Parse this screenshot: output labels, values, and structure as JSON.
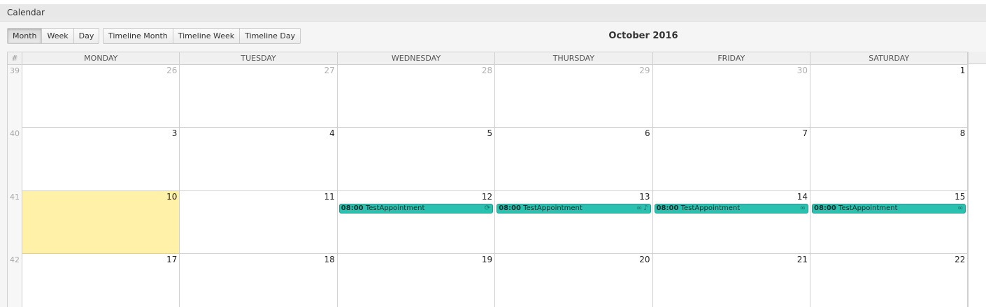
{
  "panel": {
    "title": "Calendar"
  },
  "views": {
    "basic": [
      {
        "label": "Month",
        "active": true
      },
      {
        "label": "Week",
        "active": false
      },
      {
        "label": "Day",
        "active": false
      }
    ],
    "timeline": [
      {
        "label": "Timeline Month",
        "active": false
      },
      {
        "label": "Timeline Week",
        "active": false
      },
      {
        "label": "Timeline Day",
        "active": false
      }
    ]
  },
  "calendar": {
    "title": "October 2016",
    "week_header": "#",
    "days": [
      "MONDAY",
      "TUESDAY",
      "WEDNESDAY",
      "THURSDAY",
      "FRIDAY",
      "SATURDAY"
    ],
    "weeks": [
      {
        "num": "39",
        "dates": [
          {
            "d": "26",
            "other": true
          },
          {
            "d": "27",
            "other": true
          },
          {
            "d": "28",
            "other": true
          },
          {
            "d": "29",
            "other": true
          },
          {
            "d": "30",
            "other": true
          },
          {
            "d": "1",
            "other": false
          }
        ]
      },
      {
        "num": "40",
        "dates": [
          {
            "d": "3"
          },
          {
            "d": "4"
          },
          {
            "d": "5"
          },
          {
            "d": "6"
          },
          {
            "d": "7"
          },
          {
            "d": "8"
          }
        ]
      },
      {
        "num": "41",
        "dates": [
          {
            "d": "10",
            "today": true
          },
          {
            "d": "11"
          },
          {
            "d": "12",
            "event": 0
          },
          {
            "d": "13",
            "event": 1
          },
          {
            "d": "14",
            "event": 2
          },
          {
            "d": "15",
            "event": 3
          }
        ]
      },
      {
        "num": "42",
        "dates": [
          {
            "d": "17"
          },
          {
            "d": "18"
          },
          {
            "d": "19"
          },
          {
            "d": "20"
          },
          {
            "d": "21"
          },
          {
            "d": "22"
          }
        ]
      }
    ],
    "events": [
      {
        "time": "08:00",
        "title": "TestAppointment",
        "icons": [
          "recurring-icon"
        ]
      },
      {
        "time": "08:00",
        "title": "TestAppointment",
        "icons": [
          "link-icon",
          "bell-icon"
        ]
      },
      {
        "time": "08:00",
        "title": "TestAppointment",
        "icons": [
          "link-icon"
        ]
      },
      {
        "time": "08:00",
        "title": "TestAppointment",
        "icons": [
          "link-icon"
        ]
      }
    ],
    "colors": {
      "today": "#fff2a8",
      "event": "#2bc1b0"
    }
  }
}
